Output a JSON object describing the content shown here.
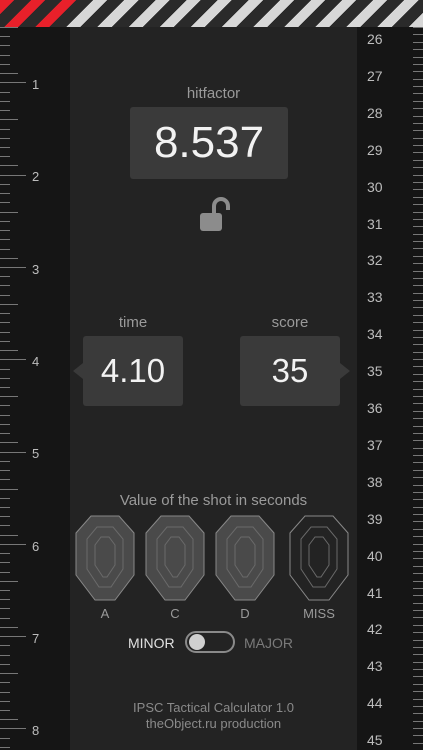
{
  "ruler_left": [
    "1",
    "2",
    "3",
    "4",
    "5",
    "6",
    "7",
    "8"
  ],
  "ruler_right": [
    "26",
    "27",
    "28",
    "29",
    "30",
    "31",
    "32",
    "33",
    "34",
    "35",
    "36",
    "37",
    "38",
    "39",
    "40",
    "41",
    "42",
    "43",
    "44",
    "45"
  ],
  "hitfactor": {
    "label": "hitfactor",
    "value": "8.537"
  },
  "time": {
    "label": "time",
    "value": "4.10"
  },
  "score": {
    "label": "score",
    "value": "35"
  },
  "shot_value_label": "Value of the shot in seconds",
  "targets": [
    {
      "label": "A"
    },
    {
      "label": "C"
    },
    {
      "label": "D"
    },
    {
      "label": "MISS"
    }
  ],
  "mode": {
    "minor": "MINOR",
    "major": "MAJOR",
    "selected": "MINOR"
  },
  "footer": {
    "line1": "IPSC Tactical Calculator 1.0",
    "line2": "theObject.ru production"
  },
  "colors": {
    "accent": "#e8202a",
    "panel": "#232323",
    "box": "#3a3a3a"
  }
}
